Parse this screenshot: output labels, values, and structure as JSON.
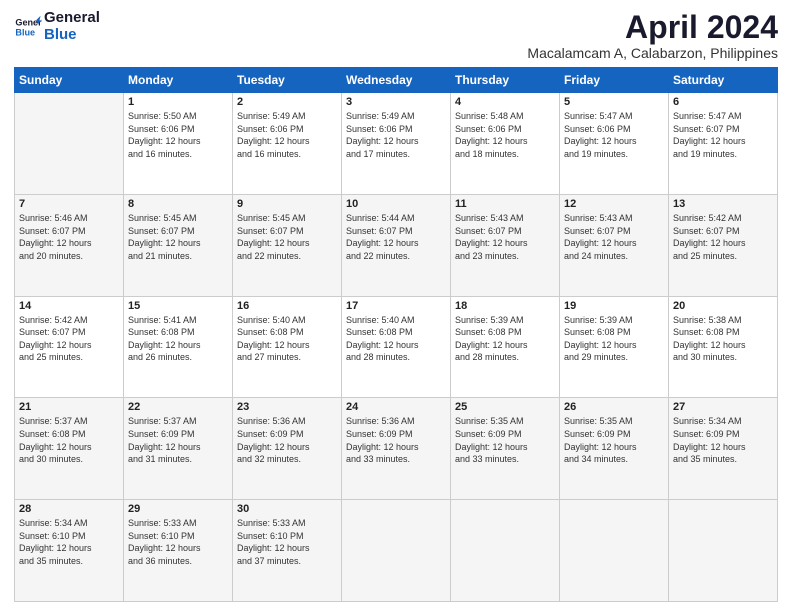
{
  "header": {
    "logo_general": "General",
    "logo_blue": "Blue",
    "month_title": "April 2024",
    "location": "Macalamcam A, Calabarzon, Philippines"
  },
  "days_of_week": [
    "Sunday",
    "Monday",
    "Tuesday",
    "Wednesday",
    "Thursday",
    "Friday",
    "Saturday"
  ],
  "weeks": [
    [
      {
        "day": "",
        "info": ""
      },
      {
        "day": "1",
        "info": "Sunrise: 5:50 AM\nSunset: 6:06 PM\nDaylight: 12 hours\nand 16 minutes."
      },
      {
        "day": "2",
        "info": "Sunrise: 5:49 AM\nSunset: 6:06 PM\nDaylight: 12 hours\nand 16 minutes."
      },
      {
        "day": "3",
        "info": "Sunrise: 5:49 AM\nSunset: 6:06 PM\nDaylight: 12 hours\nand 17 minutes."
      },
      {
        "day": "4",
        "info": "Sunrise: 5:48 AM\nSunset: 6:06 PM\nDaylight: 12 hours\nand 18 minutes."
      },
      {
        "day": "5",
        "info": "Sunrise: 5:47 AM\nSunset: 6:06 PM\nDaylight: 12 hours\nand 19 minutes."
      },
      {
        "day": "6",
        "info": "Sunrise: 5:47 AM\nSunset: 6:07 PM\nDaylight: 12 hours\nand 19 minutes."
      }
    ],
    [
      {
        "day": "7",
        "info": "Sunrise: 5:46 AM\nSunset: 6:07 PM\nDaylight: 12 hours\nand 20 minutes."
      },
      {
        "day": "8",
        "info": "Sunrise: 5:45 AM\nSunset: 6:07 PM\nDaylight: 12 hours\nand 21 minutes."
      },
      {
        "day": "9",
        "info": "Sunrise: 5:45 AM\nSunset: 6:07 PM\nDaylight: 12 hours\nand 22 minutes."
      },
      {
        "day": "10",
        "info": "Sunrise: 5:44 AM\nSunset: 6:07 PM\nDaylight: 12 hours\nand 22 minutes."
      },
      {
        "day": "11",
        "info": "Sunrise: 5:43 AM\nSunset: 6:07 PM\nDaylight: 12 hours\nand 23 minutes."
      },
      {
        "day": "12",
        "info": "Sunrise: 5:43 AM\nSunset: 6:07 PM\nDaylight: 12 hours\nand 24 minutes."
      },
      {
        "day": "13",
        "info": "Sunrise: 5:42 AM\nSunset: 6:07 PM\nDaylight: 12 hours\nand 25 minutes."
      }
    ],
    [
      {
        "day": "14",
        "info": "Sunrise: 5:42 AM\nSunset: 6:07 PM\nDaylight: 12 hours\nand 25 minutes."
      },
      {
        "day": "15",
        "info": "Sunrise: 5:41 AM\nSunset: 6:08 PM\nDaylight: 12 hours\nand 26 minutes."
      },
      {
        "day": "16",
        "info": "Sunrise: 5:40 AM\nSunset: 6:08 PM\nDaylight: 12 hours\nand 27 minutes."
      },
      {
        "day": "17",
        "info": "Sunrise: 5:40 AM\nSunset: 6:08 PM\nDaylight: 12 hours\nand 28 minutes."
      },
      {
        "day": "18",
        "info": "Sunrise: 5:39 AM\nSunset: 6:08 PM\nDaylight: 12 hours\nand 28 minutes."
      },
      {
        "day": "19",
        "info": "Sunrise: 5:39 AM\nSunset: 6:08 PM\nDaylight: 12 hours\nand 29 minutes."
      },
      {
        "day": "20",
        "info": "Sunrise: 5:38 AM\nSunset: 6:08 PM\nDaylight: 12 hours\nand 30 minutes."
      }
    ],
    [
      {
        "day": "21",
        "info": "Sunrise: 5:37 AM\nSunset: 6:08 PM\nDaylight: 12 hours\nand 30 minutes."
      },
      {
        "day": "22",
        "info": "Sunrise: 5:37 AM\nSunset: 6:09 PM\nDaylight: 12 hours\nand 31 minutes."
      },
      {
        "day": "23",
        "info": "Sunrise: 5:36 AM\nSunset: 6:09 PM\nDaylight: 12 hours\nand 32 minutes."
      },
      {
        "day": "24",
        "info": "Sunrise: 5:36 AM\nSunset: 6:09 PM\nDaylight: 12 hours\nand 33 minutes."
      },
      {
        "day": "25",
        "info": "Sunrise: 5:35 AM\nSunset: 6:09 PM\nDaylight: 12 hours\nand 33 minutes."
      },
      {
        "day": "26",
        "info": "Sunrise: 5:35 AM\nSunset: 6:09 PM\nDaylight: 12 hours\nand 34 minutes."
      },
      {
        "day": "27",
        "info": "Sunrise: 5:34 AM\nSunset: 6:09 PM\nDaylight: 12 hours\nand 35 minutes."
      }
    ],
    [
      {
        "day": "28",
        "info": "Sunrise: 5:34 AM\nSunset: 6:10 PM\nDaylight: 12 hours\nand 35 minutes."
      },
      {
        "day": "29",
        "info": "Sunrise: 5:33 AM\nSunset: 6:10 PM\nDaylight: 12 hours\nand 36 minutes."
      },
      {
        "day": "30",
        "info": "Sunrise: 5:33 AM\nSunset: 6:10 PM\nDaylight: 12 hours\nand 37 minutes."
      },
      {
        "day": "",
        "info": ""
      },
      {
        "day": "",
        "info": ""
      },
      {
        "day": "",
        "info": ""
      },
      {
        "day": "",
        "info": ""
      }
    ]
  ]
}
